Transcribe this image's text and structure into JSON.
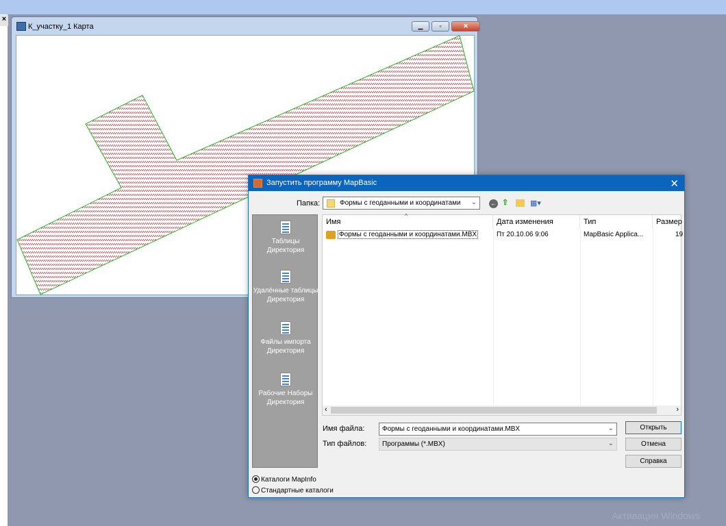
{
  "map_window": {
    "title": "К_участку_1 Карта",
    "fill_color": "#c02030",
    "border_color": "#22bb22"
  },
  "dialog": {
    "title": "Запустить программу MapBasic",
    "folder_label": "Папка:",
    "folder_value": "Формы с геоданными и координатами",
    "places": [
      {
        "label": "Таблицы Директория"
      },
      {
        "label": "Удалённые таблицы Директория"
      },
      {
        "label": "Файлы импорта Директория"
      },
      {
        "label": "Рабочие Наборы Директория"
      }
    ],
    "columns": [
      "Имя",
      "Дата изменения",
      "Тип",
      "Размер"
    ],
    "files": [
      {
        "name": "Формы с геоданными и координатами.MBX",
        "date": "Пт 20.10.06 9:06",
        "type": "MapBasic Applica...",
        "size": "19"
      }
    ],
    "filename_label": "Имя файла:",
    "filename_value": "Формы с геоданными и координатами.MBX",
    "filetype_label": "Тип файлов:",
    "filetype_value": "Программы (*.MBX)",
    "open": "Открыть",
    "cancel": "Отмена",
    "help": "Справка",
    "radio_mapinfo": "Каталоги MapInfo",
    "radio_standard": "Стандартные каталоги"
  },
  "watermark": "Активация Windows"
}
